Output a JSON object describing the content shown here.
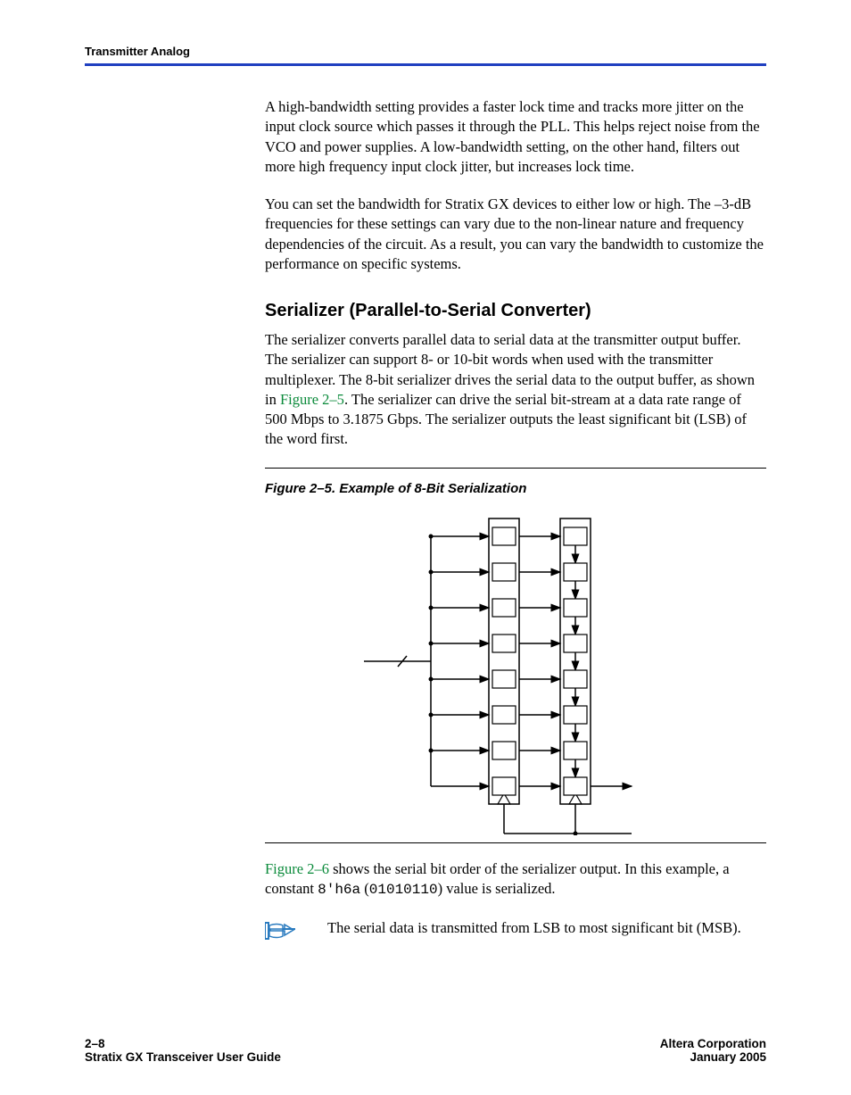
{
  "header": {
    "section_title": "Transmitter Analog"
  },
  "body": {
    "para1": "A high-bandwidth setting provides a faster lock time and tracks more jitter on the input clock source which passes it through the PLL. This helps reject noise from the VCO and power supplies. A low-bandwidth setting, on the other hand, filters out more high frequency input clock jitter, but increases lock time.",
    "para2": "You can set the bandwidth for Stratix GX devices to either low or high. The –3-dB frequencies for these settings can vary due to the non-linear nature and frequency dependencies of the circuit. As a result, you can vary the bandwidth to customize the performance on specific systems.",
    "heading": "Serializer (Parallel-to-Serial Converter)",
    "para3_a": "The serializer converts parallel data to serial data at the transmitter output buffer. The serializer can support 8- or 10-bit words when used with the transmitter multiplexer. The 8-bit serializer drives the serial data to the output buffer, as shown in ",
    "para3_link": "Figure 2–5",
    "para3_b": ". The serializer can drive the serial bit-stream at a data rate range of 500 Mbps to 3.1875 Gbps. The serializer outputs the least significant bit (LSB) of the word first.",
    "fig_caption": "Figure 2–5. Example of 8-Bit Serialization",
    "para4_link": "Figure 2–6",
    "para4_a": " shows the serial bit order of the serializer output. In this example, a constant ",
    "para4_code1": "8'h6a",
    "para4_mid": " (",
    "para4_code2": "01010110",
    "para4_b": ") value is serialized.",
    "note": "The serial data is transmitted from LSB to most significant bit (MSB)."
  },
  "footer": {
    "page_num": "2–8",
    "doc_title": "Stratix GX Transceiver User Guide",
    "company": "Altera Corporation",
    "date": "January 2005"
  }
}
